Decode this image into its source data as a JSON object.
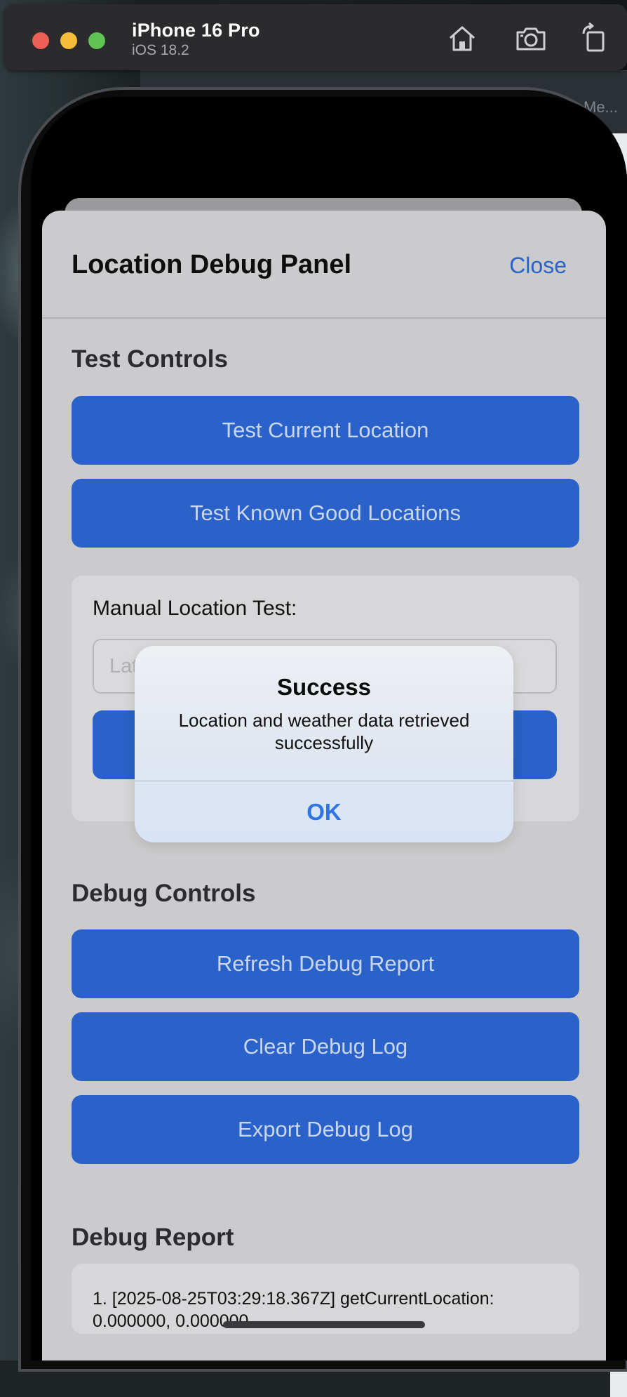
{
  "simulator": {
    "device_name": "iPhone 16 Pro",
    "os_version": "iOS 18.2",
    "background_window_text": "Me..."
  },
  "panel": {
    "title": "Location Debug Panel",
    "close_label": "Close"
  },
  "test_controls": {
    "heading": "Test Controls",
    "buttons": [
      "Test Current Location",
      "Test Known Good Locations"
    ]
  },
  "manual_test": {
    "label": "Manual Location Test:",
    "latitude_placeholder": "Lat"
  },
  "debug_controls": {
    "heading": "Debug Controls",
    "buttons": [
      "Refresh Debug Report",
      "Clear Debug Log",
      "Export Debug Log"
    ]
  },
  "debug_report": {
    "heading": "Debug Report",
    "entries": [
      "1. [2025-08-25T03:29:18.367Z] getCurrentLocation: 0.000000, 0.000000"
    ]
  },
  "alert": {
    "title": "Success",
    "message": "Location and weather data retrieved successfully",
    "ok_label": "OK"
  },
  "colors": {
    "accent": "#2a62c9",
    "link": "#2a63c6",
    "alert_button": "#2f74e0"
  }
}
